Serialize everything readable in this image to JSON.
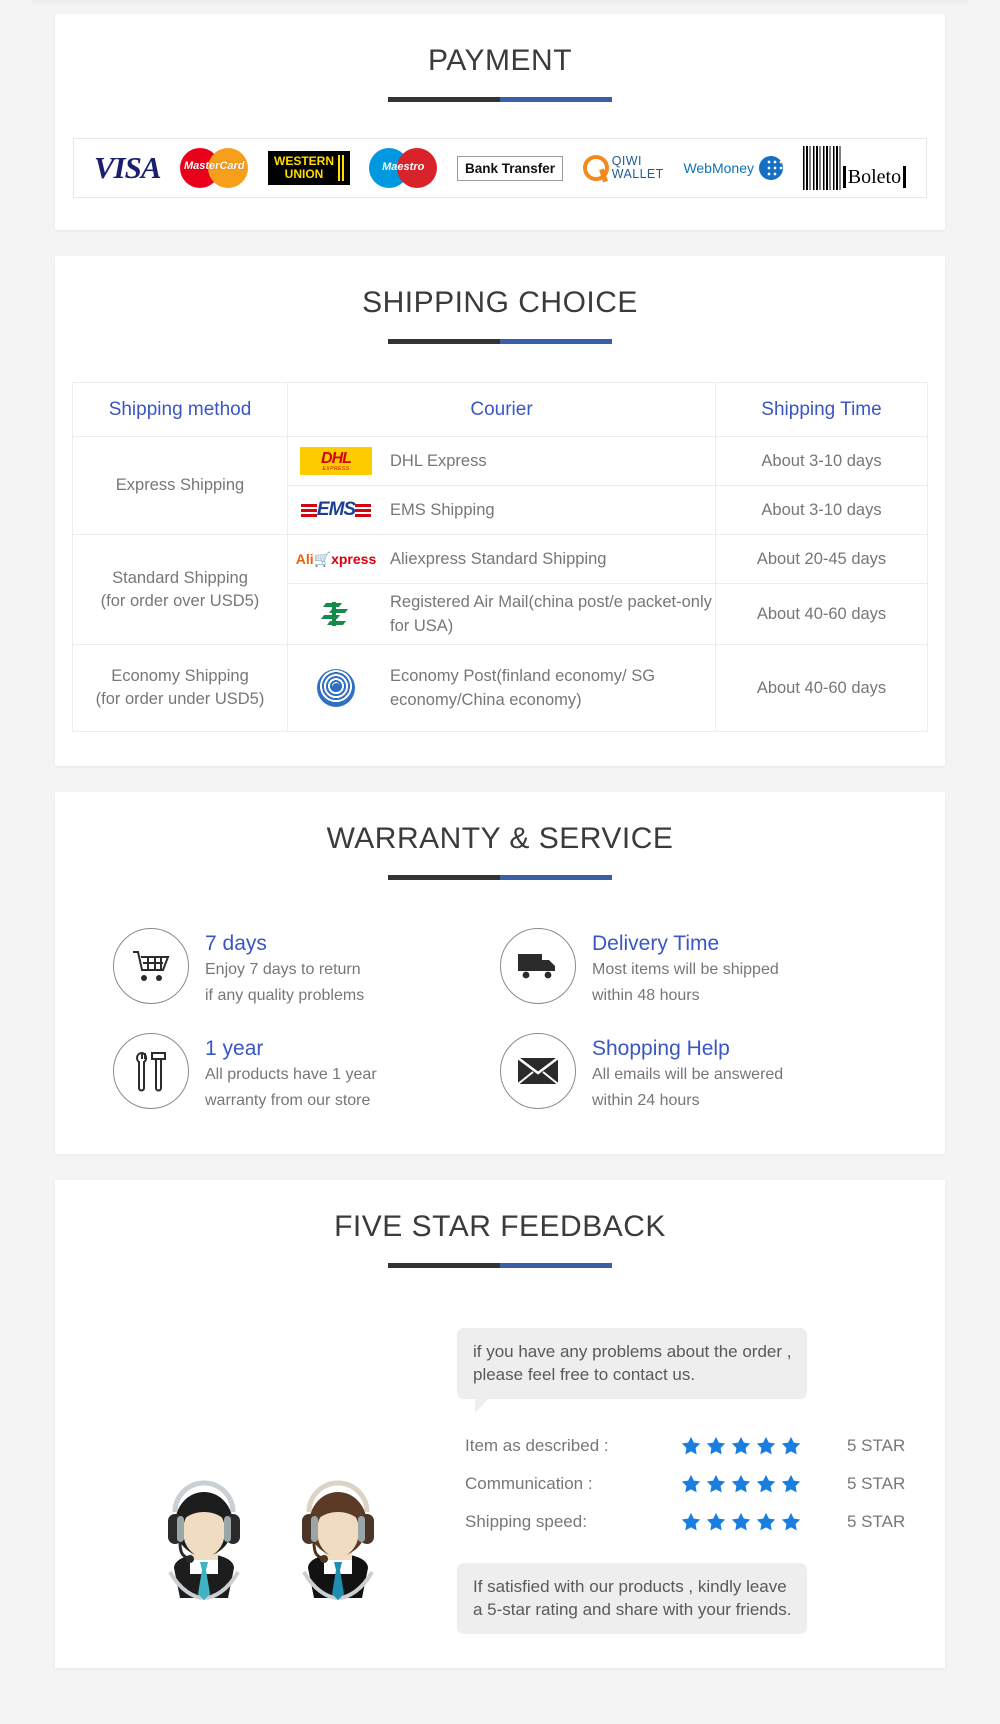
{
  "sections": {
    "payment": {
      "title": "PAYMENT",
      "methods": [
        {
          "name": "visa-logo",
          "label": "VISA"
        },
        {
          "name": "mastercard-logo",
          "label": "MasterCard"
        },
        {
          "name": "western-union-logo",
          "label": "WESTERN UNION",
          "line1": "WESTERN",
          "line2": "UNION"
        },
        {
          "name": "maestro-logo",
          "label": "Maestro"
        },
        {
          "name": "bank-transfer-logo",
          "label": "Bank Transfer"
        },
        {
          "name": "qiwi-wallet-logo",
          "label": "QIWI WALLET",
          "line1": "QIWI",
          "line2": "WALLET"
        },
        {
          "name": "webmoney-logo",
          "label": "WebMoney"
        },
        {
          "name": "boleto-logo",
          "label": "Boleto"
        }
      ]
    },
    "shipping": {
      "title": "SHIPPING CHOICE",
      "columns": [
        "Shipping method",
        "Courier",
        "Shipping Time"
      ],
      "rows": [
        {
          "method": "Express Shipping",
          "method_line2": "",
          "span": 2,
          "couriers": [
            {
              "logo": "dhl-logo",
              "name": "DHL Express",
              "time": "About 3-10 days"
            },
            {
              "logo": "ems-logo",
              "name": "EMS Shipping",
              "time": "About 3-10 days"
            }
          ]
        },
        {
          "method": "Standard Shipping",
          "method_line2": "(for order over USD5)",
          "span": 2,
          "couriers": [
            {
              "logo": "aliexpress-logo",
              "name": "Aliexpress Standard Shipping",
              "time": "About 20-45 days"
            },
            {
              "logo": "china-post-logo",
              "name": "Registered Air Mail(china post/e packet-only for USA)",
              "time": "About 40-60 days"
            }
          ]
        },
        {
          "method": "Economy Shipping",
          "method_line2": "(for order under USD5)",
          "span": 1,
          "couriers": [
            {
              "logo": "un-post-logo",
              "name": "Economy Post(finland economy/ SG economy/China economy)",
              "time": "About 40-60 days"
            }
          ]
        }
      ]
    },
    "warranty": {
      "title": "WARRANTY & SERVICE",
      "items": [
        {
          "icon": "shopping-cart-icon",
          "heading": "7 days",
          "line1": "Enjoy 7 days to return",
          "line2": "if any quality problems"
        },
        {
          "icon": "delivery-truck-icon",
          "heading": "Delivery Time",
          "line1": "Most items will be shipped",
          "line2": "within 48 hours"
        },
        {
          "icon": "wrench-hammer-icon",
          "heading": "1 year",
          "line1": "All products have 1 year",
          "line2": "warranty from our store"
        },
        {
          "icon": "envelope-icon",
          "heading": "Shopping Help",
          "line1": "All emails will be answered",
          "line2": "within 24 hours"
        }
      ]
    },
    "feedback": {
      "title": "FIVE STAR FEEDBACK",
      "bubble_top_line1": "if you have any problems about the order ,",
      "bubble_top_line2": "please feel free to contact us.",
      "bubble_bottom_line1": "If satisfied with our products ,  kindly leave",
      "bubble_bottom_line2": "a 5-star rating and share with your friends.",
      "ratings": [
        {
          "label": "Item as described :",
          "stars": 5,
          "value": "5 STAR"
        },
        {
          "label": "Communication :",
          "stars": 5,
          "value": "5 STAR"
        },
        {
          "label": "Shipping speed:",
          "stars": 5,
          "value": "5 STAR"
        }
      ],
      "agents": [
        "agent-avatar-female",
        "agent-avatar-male"
      ]
    }
  },
  "colors": {
    "heading_blue": "#3a56c4",
    "rule_dark": "#333333",
    "rule_blue": "#3a5fa8",
    "body_gray": "#777777",
    "star_blue": "#1a7de0",
    "page_bg": "#f4f4f4"
  }
}
